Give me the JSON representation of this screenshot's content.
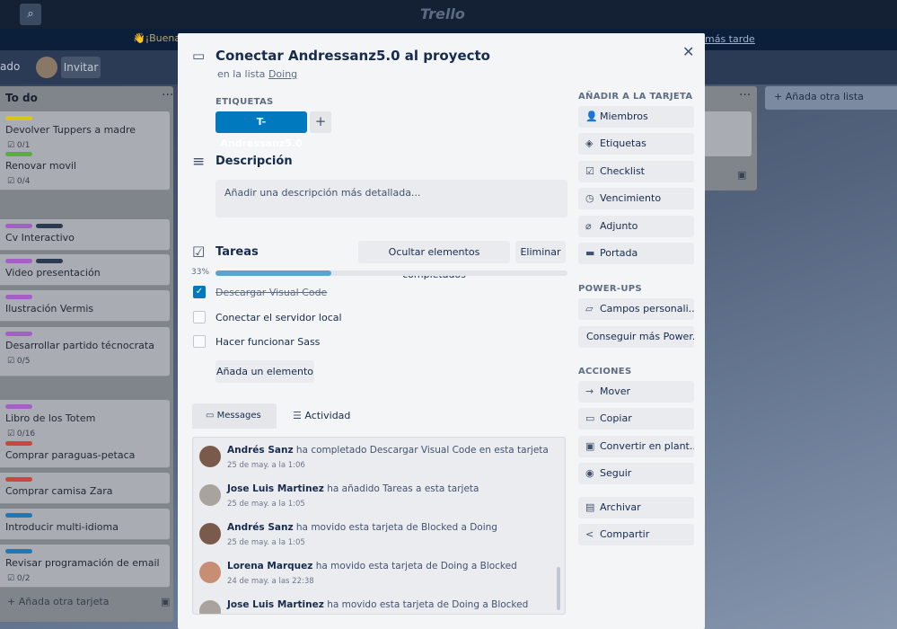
{
  "topbar": {
    "logo": "Trello"
  },
  "banner": {
    "left_text": "👋¡Buenas",
    "right_link": "más tarde"
  },
  "boardbar": {
    "partial_text": "ado",
    "invite_label": "Invitar"
  },
  "list": {
    "title": "To do",
    "cards": [
      {
        "title": "Devolver Tuppers a madre",
        "badge": "☑ 0/1",
        "labels": [
          "#d9c41a"
        ]
      },
      {
        "title": "Renovar movil",
        "badge": "☑ 0/4",
        "labels": [
          "#5aac44"
        ]
      },
      {
        "title": "Cv Interactivo",
        "badge": "",
        "labels": [
          "#a25fc4",
          "#2b3a50"
        ]
      },
      {
        "title": "Video presentación",
        "badge": "",
        "labels": [
          "#a25fc4",
          "#2b3a50"
        ]
      },
      {
        "title": "Ilustración Vermis",
        "badge": "",
        "labels": [
          "#a25fc4"
        ]
      },
      {
        "title": "Desarrollar partido técnocrata",
        "badge": "☑ 0/5",
        "labels": [
          "#a25fc4"
        ]
      },
      {
        "title": "Libro de los Totem",
        "badge": "☑ 0/16",
        "labels": [
          "#a25fc4"
        ]
      },
      {
        "title": "Comprar paraguas-petaca",
        "badge": "",
        "labels": [
          "#c9483a"
        ]
      },
      {
        "title": "Comprar camisa Zara",
        "badge": "",
        "labels": [
          "#c9483a"
        ]
      },
      {
        "title": "Introducir multi-idioma",
        "badge": "",
        "labels": [
          "#1f77b4"
        ]
      },
      {
        "title": "Revisar programación de email",
        "badge": "☑ 0/2",
        "labels": [
          "#1f77b4"
        ]
      }
    ],
    "add_card": "Añada otra tarjeta"
  },
  "add_list": "Añada otra lista",
  "modal": {
    "title": "Conectar Andressanz5.0 al proyecto",
    "list_prefix": "en la lista",
    "list_name": "Doing",
    "labels_heading": "ETIQUETAS",
    "label_tag": "T- Andressanz5.0",
    "description_heading": "Descripción",
    "description_placeholder": "Añadir una descripción más detallada...",
    "checklist": {
      "heading": "Tareas",
      "hide_button": "Ocultar elementos completados",
      "delete_button": "Eliminar",
      "progress_label": "33%",
      "progress": 0.33,
      "items": [
        {
          "text": "Descargar Visual Code",
          "done": true
        },
        {
          "text": "Conectar el servidor local",
          "done": false
        },
        {
          "text": "Hacer funcionar Sass",
          "done": false
        }
      ],
      "add_item": "Añada un elemento"
    },
    "tabs": [
      {
        "label": "Messages"
      },
      {
        "label": "Actividad"
      }
    ],
    "activity": [
      {
        "user": "Andrés Sanz",
        "action": "ha completado Descargar Visual Code en esta tarjeta",
        "time": "25 de may. a la 1:06"
      },
      {
        "user": "Jose Luis Martinez",
        "action": "ha añadido Tareas a esta tarjeta",
        "time": "25 de may. a la 1:05"
      },
      {
        "user": "Andrés Sanz",
        "action": "ha movido esta tarjeta de Blocked a Doing",
        "time": "25 de may. a la 1:05"
      },
      {
        "user": "Lorena Marquez",
        "action": "ha movido esta tarjeta de Doing a Blocked",
        "time": "24 de may. a las 22:38"
      },
      {
        "user": "Jose Luis Martinez",
        "action": "ha movido esta tarjeta de Doing a Blocked",
        "time": ""
      }
    ],
    "sidebar": {
      "add_heading": "AÑADIR A LA TARJETA",
      "add_items": [
        "Miembros",
        "Etiquetas",
        "Checklist",
        "Vencimiento",
        "Adjunto",
        "Portada"
      ],
      "powerups_heading": "POWER-UPS",
      "powerups_items": [
        "Campos personali...",
        "Conseguir más Power..."
      ],
      "actions_heading": "ACCIONES",
      "actions_items": [
        "Mover",
        "Copiar",
        "Convertir en plant...",
        "Seguir",
        "Archivar",
        "Compartir"
      ]
    }
  }
}
